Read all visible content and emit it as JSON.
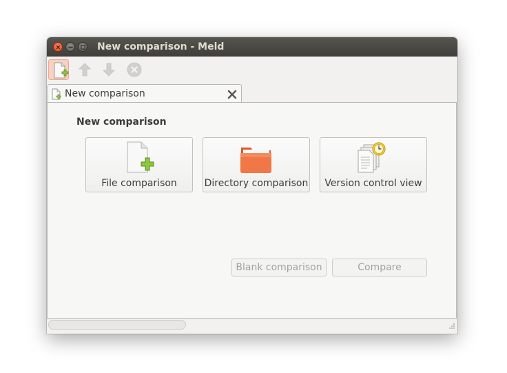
{
  "window": {
    "title": "New comparison - Meld"
  },
  "titlebar_buttons": {
    "close": "close-icon",
    "minimize": "minimize-icon",
    "maximize": "maximize-icon"
  },
  "toolbar": {
    "items": [
      {
        "icon": "new-comparison-icon",
        "state": "active"
      },
      {
        "icon": "arrow-up-icon",
        "state": "disabled"
      },
      {
        "icon": "arrow-down-icon",
        "state": "disabled"
      },
      {
        "icon": "stop-icon",
        "state": "disabled"
      }
    ]
  },
  "tabs": [
    {
      "label": "New comparison",
      "icon": "new-file-icon",
      "close_icon": "close-tab-icon"
    }
  ],
  "main": {
    "heading": "New comparison",
    "comparison_types": [
      {
        "label": "File comparison",
        "icon": "file-add-icon"
      },
      {
        "label": "Directory comparison",
        "icon": "folder-icon"
      },
      {
        "label": "Version control view",
        "icon": "version-control-icon"
      }
    ],
    "actions": {
      "blank": "Blank comparison",
      "compare": "Compare"
    }
  },
  "colors": {
    "titlebar": "#4a4844",
    "close_button": "#e8572c",
    "folder": "#f07746",
    "add_green": "#8dc63f"
  }
}
